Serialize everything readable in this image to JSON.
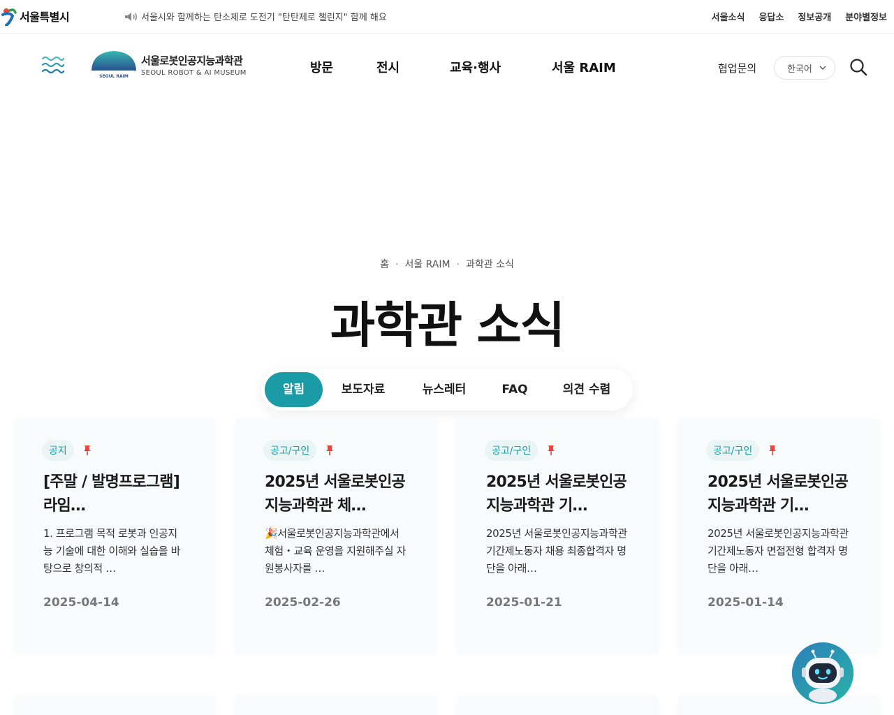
{
  "topbar": {
    "logo_name": "서울특별시",
    "notice": "서울시와 함께하는 탄소제로 도전기 \"탄탄제로 챌린지\" 함께 해요",
    "links": [
      "서울소식",
      "응답소",
      "정보공개",
      "분야별정보"
    ]
  },
  "header": {
    "brand_ko": "서울로봇인공지능과학관",
    "brand_en": "SEOUL ROBOT & AI MUSEUM",
    "brand_mark": "SEOUL RAIM",
    "nav": [
      "방문",
      "전시",
      "교육·행사",
      "서울 RAIM"
    ],
    "partner": "협업문의",
    "language": "한국어"
  },
  "breadcrumb": [
    "홈",
    "서울 RAIM",
    "과학관 소식"
  ],
  "page_title": "과학관 소식",
  "tabs": [
    {
      "label": "알림",
      "active": true
    },
    {
      "label": "보도자료",
      "active": false
    },
    {
      "label": "뉴스레터",
      "active": false
    },
    {
      "label": "FAQ",
      "active": false
    },
    {
      "label": "의견 수렴",
      "active": false
    }
  ],
  "cards": [
    {
      "category": "공지",
      "title": "[주말 / 발명프로그램] 라임…",
      "excerpt": "1. 프로그램 목적 로봇과 인공지능 기술에 대한 이해와 실습을 바탕으로 창의적 …",
      "date": "2025-04-14"
    },
    {
      "category": "공고/구인",
      "title": "2025년 서울로봇인공지능과학관 체…",
      "excerpt": "🎉서울로봇인공지능과학관에서 체험・교육 운영을 지원해주실 자원봉사자를 …",
      "date": "2025-02-26"
    },
    {
      "category": "공고/구인",
      "title": "2025년 서울로봇인공지능과학관 기…",
      "excerpt": "2025년 서울로봇인공지능과학관 기간제노동자 채용 최종합격자 명단을 아래…",
      "date": "2025-01-21"
    },
    {
      "category": "공고/구인",
      "title": "2025년 서울로봇인공지능과학관 기…",
      "excerpt": "2025년 서울로봇인공지능과학관 기간제노동자 면접전형 합격자 명단을 아래…",
      "date": "2025-01-14"
    }
  ],
  "colors": {
    "accent": "#1a9ba6",
    "pin": "#e8453c",
    "card_bg": "#f7fbfb"
  },
  "icons": {
    "menu": "wave-menu-icon",
    "search": "search-icon",
    "pin": "pin-icon",
    "notice": "speaker-icon",
    "chatbot": "robot-icon"
  }
}
